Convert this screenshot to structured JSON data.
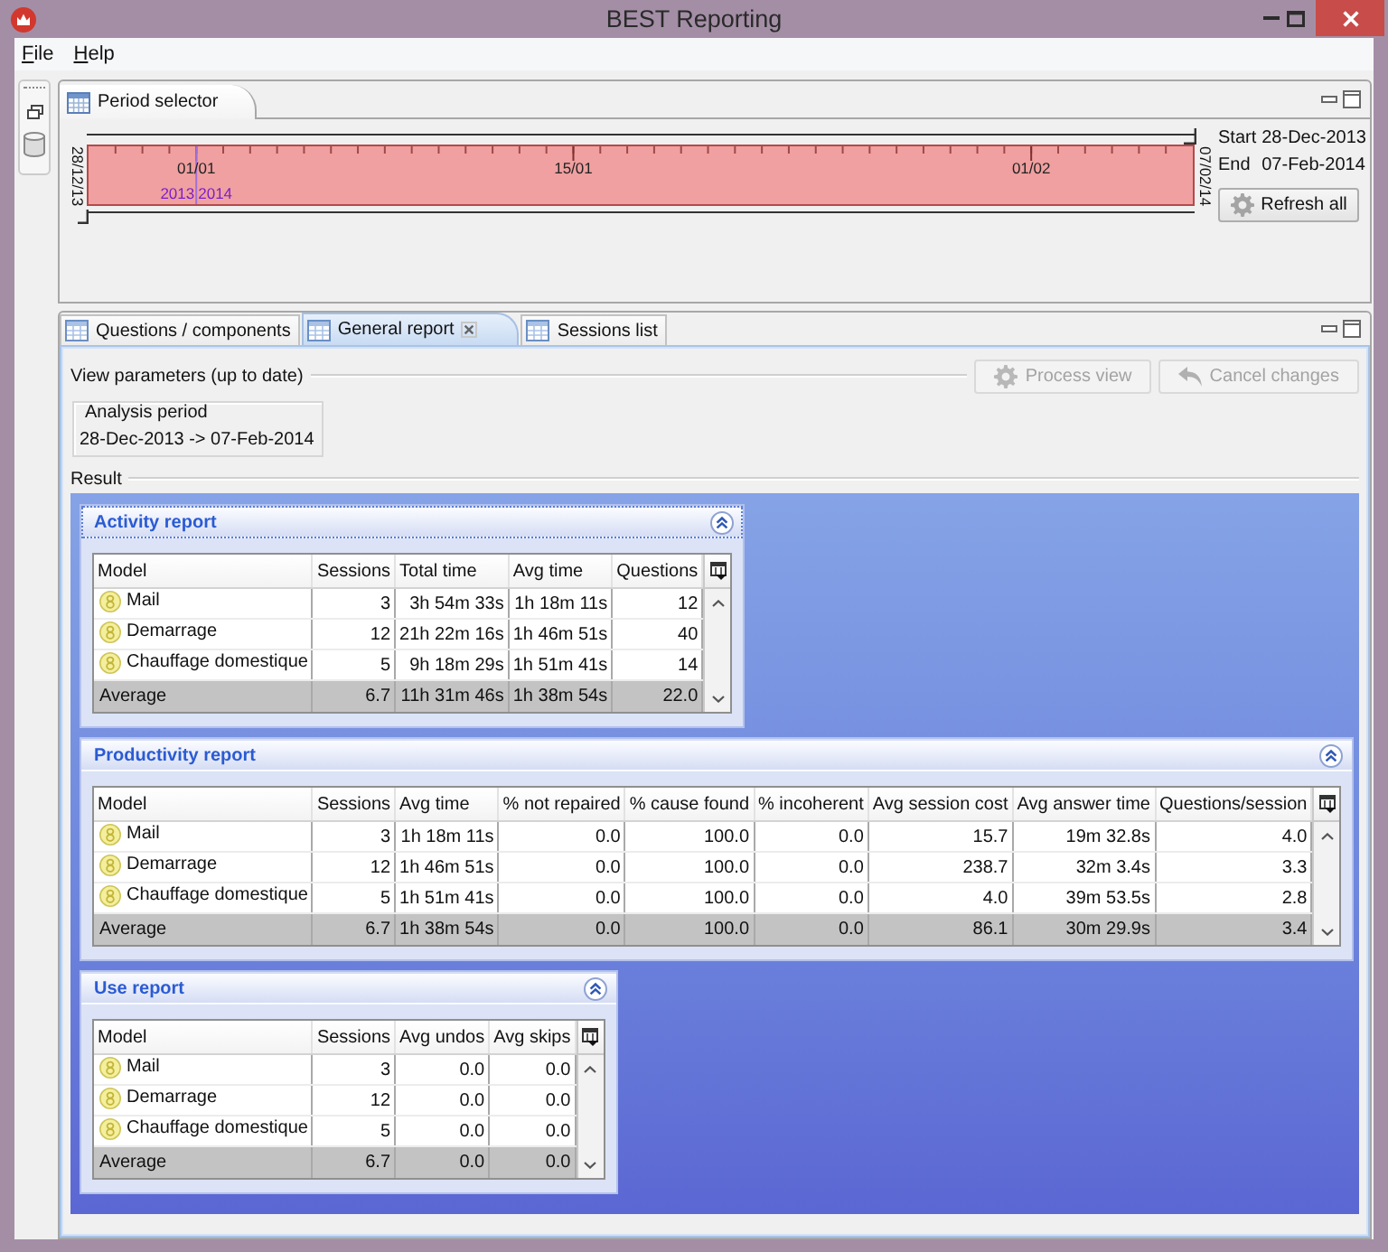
{
  "window": {
    "title": "BEST Reporting"
  },
  "menu": [
    "File",
    "Help"
  ],
  "period_selector": {
    "tab": "Period selector",
    "timeline": {
      "start_label": "28/12/13",
      "end_label": "07/02/14",
      "ticks": [
        "01/01",
        "15/01",
        "01/02"
      ],
      "year_boundary": {
        "before": "2013",
        "after": "2014"
      },
      "end_slider": {
        "level": 1
      },
      "start_slider": {
        "level": 0
      }
    },
    "range": {
      "start": {
        "label": "Start",
        "value": "28-Dec-2013"
      },
      "end": {
        "label": "End",
        "value": "07-Feb-2014"
      }
    },
    "refresh_button": "Refresh all"
  },
  "report_tabs": [
    {
      "label": "Questions / components",
      "selected": false,
      "closable": false
    },
    {
      "label": "General report",
      "selected": true,
      "closable": true
    },
    {
      "label": "Sessions list",
      "selected": false,
      "closable": false
    }
  ],
  "view_parameters": {
    "title": "View parameters (up to date)",
    "buttons": [
      {
        "kind": "process",
        "label": "Process view",
        "disabled": true
      },
      {
        "kind": "cancel",
        "label": "Cancel changes",
        "disabled": true
      }
    ],
    "analysis_period": {
      "legend": "Analysis period",
      "value": "28-Dec-2013 -> 07-Feb-2014"
    }
  },
  "result": {
    "title": "Result",
    "reports": [
      {
        "title": "Activity report",
        "expanded": true,
        "focused": true,
        "columns": [
          "Model",
          "Sessions",
          "Total time",
          "Avg time",
          "Questions"
        ],
        "rows": [
          {
            "model": "Mail",
            "values": [
              "3",
              "3h 54m 33s",
              "1h 18m 11s",
              "12"
            ]
          },
          {
            "model": "Demarrage",
            "values": [
              "12",
              "21h 22m 16s",
              "1h 46m 51s",
              "40"
            ]
          },
          {
            "model": "Chauffage domestique",
            "values": [
              "5",
              "9h 18m 29s",
              "1h 51m 41s",
              "14"
            ]
          }
        ],
        "average": {
          "label": "Average",
          "values": [
            "6.7",
            "11h 31m 46s",
            "1h 38m 54s",
            "22.0"
          ]
        }
      },
      {
        "title": "Productivity report",
        "expanded": true,
        "focused": false,
        "columns": [
          "Model",
          "Sessions",
          "Avg time",
          "% not repaired",
          "% cause found",
          "% incoherent",
          "Avg session cost",
          "Avg answer time",
          "Questions/session"
        ],
        "rows": [
          {
            "model": "Mail",
            "values": [
              "3",
              "1h 18m 11s",
              "0.0",
              "100.0",
              "0.0",
              "15.7",
              "19m 32.8s",
              "4.0"
            ]
          },
          {
            "model": "Demarrage",
            "values": [
              "12",
              "1h 46m 51s",
              "0.0",
              "100.0",
              "0.0",
              "238.7",
              "32m 3.4s",
              "3.3"
            ]
          },
          {
            "model": "Chauffage domestique",
            "values": [
              "5",
              "1h 51m 41s",
              "0.0",
              "100.0",
              "0.0",
              "4.0",
              "39m 53.5s",
              "2.8"
            ]
          }
        ],
        "average": {
          "label": "Average",
          "values": [
            "6.7",
            "1h 38m 54s",
            "0.0",
            "100.0",
            "0.0",
            "86.1",
            "30m 29.9s",
            "3.4"
          ]
        }
      },
      {
        "title": "Use report",
        "expanded": true,
        "focused": false,
        "columns": [
          "Model",
          "Sessions",
          "Avg undos",
          "Avg skips"
        ],
        "rows": [
          {
            "model": "Mail",
            "values": [
              "3",
              "0.0",
              "0.0"
            ]
          },
          {
            "model": "Demarrage",
            "values": [
              "12",
              "0.0",
              "0.0"
            ]
          },
          {
            "model": "Chauffage domestique",
            "values": [
              "5",
              "0.0",
              "0.0"
            ]
          }
        ],
        "average": {
          "label": "Average",
          "values": [
            "6.7",
            "0.0",
            "0.0"
          ]
        }
      }
    ]
  }
}
